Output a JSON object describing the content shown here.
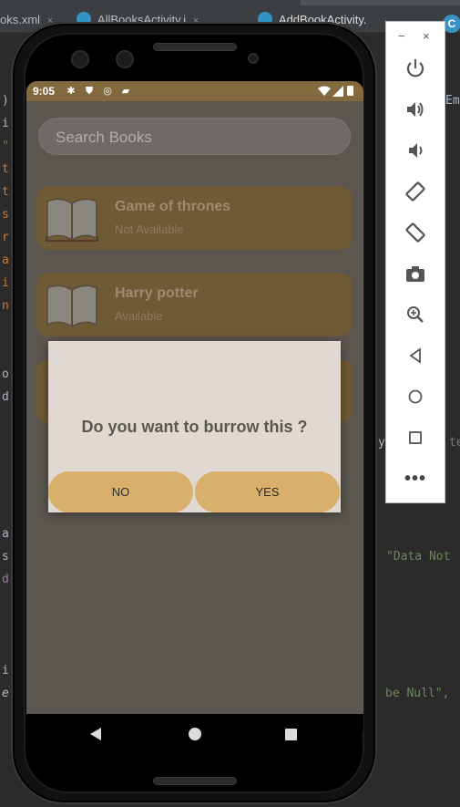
{
  "ide": {
    "tabs": [
      {
        "label": "oks.xml"
      },
      {
        "label": "AllBooksActivity.j"
      },
      {
        "label": "AddBookActivity."
      }
    ],
    "tab_icon_letter": "C",
    "code_left": [
      ")",
      "i",
      "\"",
      "t",
      "t",
      "s",
      "r",
      "a",
      "i",
      "n",
      "o",
      "d",
      "a",
      "s",
      "d",
      "i",
      "e"
    ],
    "code_right": {
      "line1": "Em",
      "line2": "Data Not",
      "line3": "be Null\",",
      "te": "te",
      "y": "y"
    }
  },
  "status_bar": {
    "time": "9:05"
  },
  "app": {
    "search_placeholder": "Search Books",
    "books": [
      {
        "title": "Game of thrones",
        "status": "Not Available"
      },
      {
        "title": "Harry potter",
        "status": "Available"
      },
      {
        "title": "",
        "status": ""
      }
    ]
  },
  "dialog": {
    "message": "Do you want to burrow this ?",
    "no_label": "NO",
    "yes_label": "YES"
  },
  "emulator": {
    "minimize": "−",
    "close": "×",
    "more": "•••"
  },
  "colors": {
    "status_bar": "#836a3e",
    "card": "#6e5a34",
    "dialog_bg": "#e0d8d2",
    "button": "#d8b06c"
  }
}
